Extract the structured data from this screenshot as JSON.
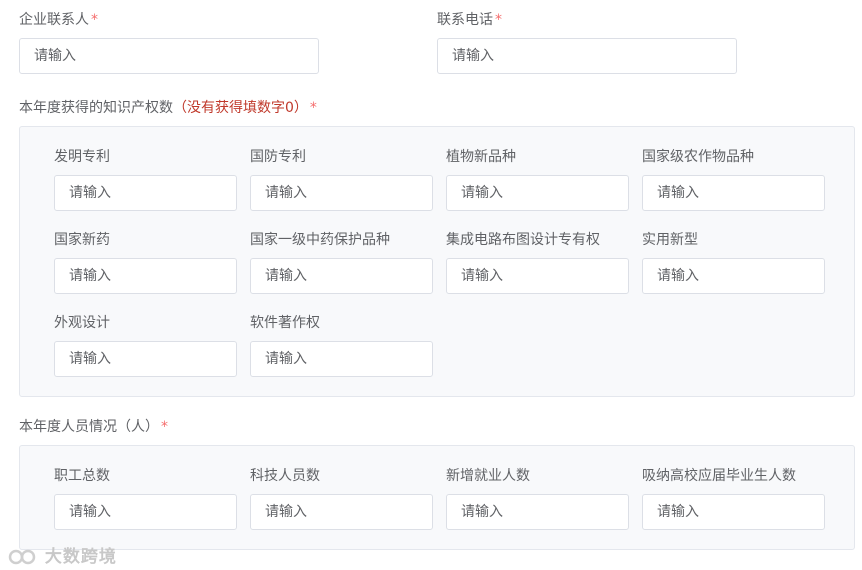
{
  "contact": {
    "label": "企业联系人",
    "placeholder": "请输入",
    "required": "*"
  },
  "phone": {
    "label": "联系电话",
    "placeholder": "请输入",
    "required": "*"
  },
  "ip_section": {
    "title": "本年度获得的知识产权数",
    "hint": "（没有获得填数字0）",
    "required": "*",
    "fields": [
      {
        "label": "发明专利",
        "placeholder": "请输入"
      },
      {
        "label": "国防专利",
        "placeholder": "请输入"
      },
      {
        "label": "植物新品种",
        "placeholder": "请输入"
      },
      {
        "label": "国家级农作物品种",
        "placeholder": "请输入"
      },
      {
        "label": "国家新药",
        "placeholder": "请输入"
      },
      {
        "label": "国家一级中药保护品种",
        "placeholder": "请输入"
      },
      {
        "label": "集成电路布图设计专有权",
        "placeholder": "请输入"
      },
      {
        "label": "实用新型",
        "placeholder": "请输入"
      },
      {
        "label": "外观设计",
        "placeholder": "请输入"
      },
      {
        "label": "软件著作权",
        "placeholder": "请输入"
      }
    ]
  },
  "staff_section": {
    "title": "本年度人员情况（人）",
    "required": "*",
    "fields": [
      {
        "label": "职工总数",
        "placeholder": "请输入"
      },
      {
        "label": "科技人员数",
        "placeholder": "请输入"
      },
      {
        "label": "新增就业人数",
        "placeholder": "请输入"
      },
      {
        "label": "吸纳高校应届毕业生人数",
        "placeholder": "请输入"
      }
    ]
  },
  "watermark": {
    "text": "大数跨境"
  }
}
